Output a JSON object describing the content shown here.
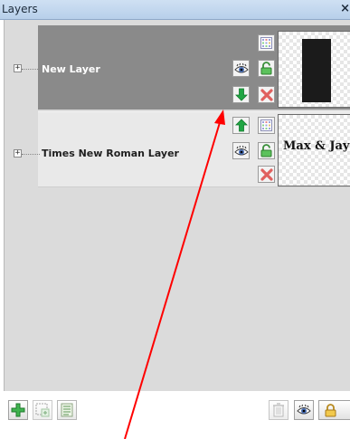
{
  "panel": {
    "title": "Layers",
    "close_label": "×"
  },
  "layers": [
    {
      "name": "New Layer",
      "selected": true,
      "thumbnail_text": ""
    },
    {
      "name": "Times New Roman Layer",
      "selected": false,
      "thumbnail_text": "Max & Jay"
    }
  ],
  "toolbar": {
    "left_buttons": [
      "add-layer-icon",
      "new-layer-icon",
      "layer-group-icon"
    ],
    "right_buttons": [
      "trash-icon",
      "eye-icon",
      "lock-icon"
    ]
  },
  "icons": {
    "expand": "+",
    "visibility": "eye-icon",
    "lock": "lock-icon",
    "delete": "delete-x-icon",
    "move_down": "arrow-down-icon",
    "move_up": "arrow-up-icon",
    "grid": "grid-icon"
  },
  "colors": {
    "selected_row": "#8a8a8a",
    "panel_bg": "#dbdbdb",
    "arrow_green": "#21a644",
    "delete_red": "#e0605e",
    "annotation_arrow": "#ff0000"
  }
}
